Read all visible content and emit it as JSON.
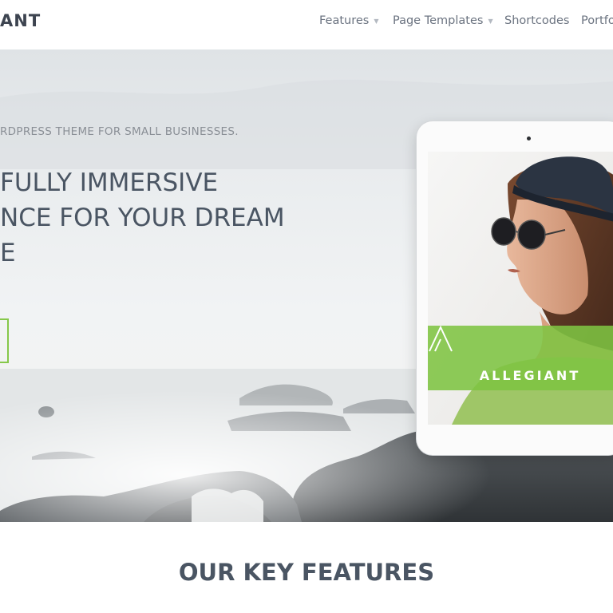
{
  "header": {
    "logo": "ANT",
    "nav": [
      {
        "label": "Features",
        "has_dropdown": true
      },
      {
        "label": "Page Templates",
        "has_dropdown": true
      },
      {
        "label": "Shortcodes",
        "has_dropdown": false
      },
      {
        "label": "Portfo",
        "has_dropdown": false
      }
    ]
  },
  "hero": {
    "tagline": "RDPRESS THEME FOR SMALL BUSINESSES.",
    "headline": [
      "FULLY IMMERSIVE",
      "NCE FOR YOUR DREAM",
      "E"
    ]
  },
  "tablet": {
    "brand_name": "ALLEGIANT"
  },
  "features": {
    "title": "OUR KEY FEATURES"
  },
  "colors": {
    "accent_green": "#86c84a",
    "heading": "#4a5563",
    "nav_text": "#6b7380"
  }
}
